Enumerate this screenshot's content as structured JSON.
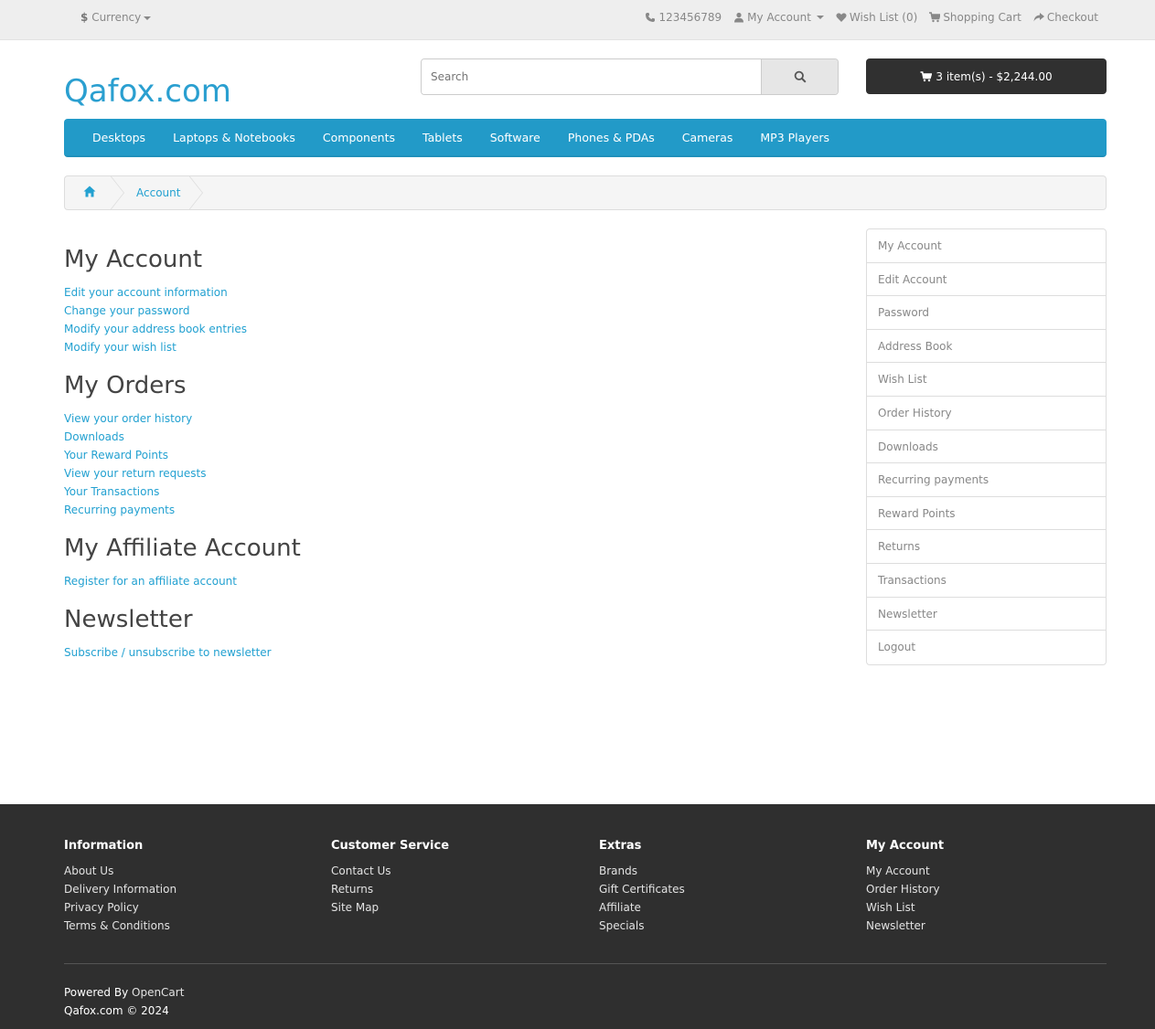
{
  "topbar": {
    "currency_symbol": "$",
    "currency_label": "Currency",
    "phone": "123456789",
    "my_account": "My Account",
    "wish_list": "Wish List (0)",
    "shopping_cart": "Shopping Cart",
    "checkout": "Checkout"
  },
  "header": {
    "logo": "Qafox.com",
    "search_placeholder": "Search",
    "cart_label": "3 item(s) - $2,244.00"
  },
  "menu": [
    "Desktops",
    "Laptops & Notebooks",
    "Components",
    "Tablets",
    "Software",
    "Phones & PDAs",
    "Cameras",
    "MP3 Players"
  ],
  "breadcrumb": {
    "current": "Account"
  },
  "sections": [
    {
      "title": "My Account",
      "links": [
        "Edit your account information",
        "Change your password",
        "Modify your address book entries",
        "Modify your wish list"
      ]
    },
    {
      "title": "My Orders",
      "links": [
        "View your order history",
        "Downloads",
        "Your Reward Points",
        "View your return requests",
        "Your Transactions",
        "Recurring payments"
      ]
    },
    {
      "title": "My Affiliate Account",
      "links": [
        "Register for an affiliate account"
      ]
    },
    {
      "title": "Newsletter",
      "links": [
        "Subscribe / unsubscribe to newsletter"
      ]
    }
  ],
  "sidebar": [
    "My Account",
    "Edit Account",
    "Password",
    "Address Book",
    "Wish List",
    "Order History",
    "Downloads",
    "Recurring payments",
    "Reward Points",
    "Returns",
    "Transactions",
    "Newsletter",
    "Logout"
  ],
  "footer": {
    "columns": [
      {
        "title": "Information",
        "links": [
          "About Us",
          "Delivery Information",
          "Privacy Policy",
          "Terms & Conditions"
        ]
      },
      {
        "title": "Customer Service",
        "links": [
          "Contact Us",
          "Returns",
          "Site Map"
        ]
      },
      {
        "title": "Extras",
        "links": [
          "Brands",
          "Gift Certificates",
          "Affiliate",
          "Specials"
        ]
      },
      {
        "title": "My Account",
        "links": [
          "My Account",
          "Order History",
          "Wish List",
          "Newsletter"
        ]
      }
    ],
    "powered_by": "Powered By",
    "powered_link": "OpenCart",
    "copyright": "Qafox.com © 2024"
  },
  "colors": {
    "accent": "#229ac8",
    "link": "#23a1d1",
    "footer_bg": "#2f2f2f",
    "cart_bg": "#303030"
  }
}
